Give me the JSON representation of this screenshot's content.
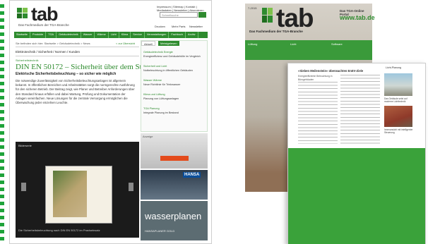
{
  "colors": {
    "brand_green": "#2e8b2e",
    "dash_green": "#1fa33a"
  },
  "website": {
    "logo": "tab",
    "tagline": "Das Fachmedium der TGA-Branche",
    "utility_links": "Impressum | Sitemap | Kontakt | Mediadaten | Newsletter | Abonnieren",
    "search_placeholder": "Schnellsuche",
    "mini_links": [
      "Drucken",
      "Mehr Parts",
      "Newsletter"
    ],
    "nav_items": [
      "Startseite",
      "Produkte",
      "TGA",
      "Gebäudetechnik",
      "Wasser",
      "Wärme",
      "Licht",
      "Klima",
      "Service",
      "Veranstaltungen",
      "Fachbuch",
      "Archiv"
    ],
    "breadcrumb": "Sie befinden sich hier: Startseite > Gebäudetechnik > News",
    "back_link": "< zur Übersicht",
    "kicker": "Elektrotechnik / Sicherheit / Normen / Kunden",
    "category": "Sicherheitstechnik",
    "headline": "DIN EN 50172 – Sicherheit über dem Standard",
    "subhead": "Elektrische Sicherheitsbeleuchtung – so sicher wie möglich",
    "body": "Die notwendige Zuverlässigkeit von Sicherheitsbeleuchtungsanlagen ist allgemein bekannt. In öffentlichen Bereichen und Arbeitsstätten sorgt die normgerechte Ausführung für den sicheren Betrieb. Der Beitrag zeigt, wie Planer und Betreiber Anforderungen über den Standard hinaus erfüllen und dabei Wartung, Prüfung und Dokumentation der Anlagen vereinfachen. Neue Lösungen für die zentrale Versorgung ermöglichen die Überwachung jeder einzelnen Leuchte.",
    "gallery_label": "Bilderserie",
    "gallery_caption": "Die Sicherheitsbeleuchtung nach DIN EN 50172 im Praxiseinsatz",
    "right_tabs": [
      "Aktuell",
      "Meistgelesen"
    ],
    "right_items": [
      {
        "link": "Gebäudetechnik Energie",
        "text": "Energieeffizienz und Gebäudehülle im Vergleich"
      },
      {
        "link": "Sicherheit und Licht",
        "text": "Notbeleuchtung in öffentlichen Gebäuden"
      },
      {
        "link": "Wasser Wärme",
        "text": "Neue Richtlinie für Trinkwasser"
      },
      {
        "link": "Klima und Lüftung",
        "text": "Planung von Lüftungsanlagen"
      },
      {
        "link": "TGA Planung",
        "text": "Integrale Planung im Bestand"
      }
    ],
    "ad1": "Anzeige",
    "ad2_title": "HANSA",
    "ad3_text": "wasserplanen",
    "ad3_sub": "HANSAPLANER GOLD"
  },
  "magazine": {
    "issue": "7-2015",
    "logo": "tab",
    "subtitle": "Das Fachmedium der TGA-Branche",
    "portal_label": "Das TGA-Online Portal",
    "portal_url": "www.tab.de",
    "strip": [
      "Lüftung",
      "Licht",
      "Software"
    ],
    "sheet_header": "Licht-Planung",
    "sheet_title": "»Sieben Meilenstein« überwachten EnEV-Ziele",
    "sheet_intro": "Energieeffiziente Beleuchtung in Bürogebäuden",
    "caption1": "Das Gebäude setzt auf moderne Lichttechnik",
    "caption2": "Innenansicht mit intelligenter Steuerung"
  }
}
